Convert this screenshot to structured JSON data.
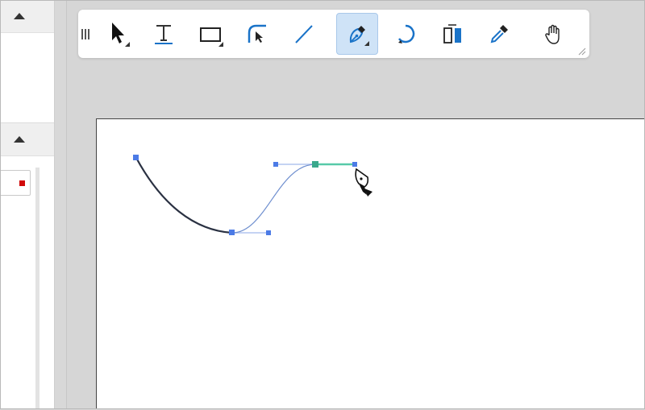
{
  "left_panel": {
    "sections": [
      {
        "name": "section-1",
        "collapse_icon": "triangle-up-icon"
      },
      {
        "name": "section-2",
        "collapse_icon": "triangle-up-icon"
      }
    ],
    "color_swatch": "#d10a0a"
  },
  "toolbar": {
    "active_tool": "pen",
    "accent_color": "#1a73c8",
    "tools": [
      {
        "id": "select",
        "icon": "pointer-arrow-icon",
        "has_submenu": true
      },
      {
        "id": "text",
        "icon": "text-t-icon",
        "has_submenu": false
      },
      {
        "id": "rectangle",
        "icon": "rectangle-icon",
        "has_submenu": true
      },
      {
        "id": "direct-select",
        "icon": "corner-select-icon",
        "has_submenu": false
      },
      {
        "id": "line",
        "icon": "line-icon",
        "has_submenu": false
      },
      {
        "id": "pen",
        "icon": "pen-nib-icon",
        "has_submenu": true
      },
      {
        "id": "lasso",
        "icon": "lasso-icon",
        "has_submenu": false
      },
      {
        "id": "fill",
        "icon": "fill-bucket-icon",
        "has_submenu": false
      },
      {
        "id": "eyedropper",
        "icon": "eyedropper-icon",
        "has_submenu": false
      },
      {
        "id": "pan",
        "icon": "hand-icon",
        "has_submenu": false
      }
    ]
  },
  "canvas": {
    "background": "#ffffff",
    "path_color": "#2a3142",
    "preview_color": "#6f8fcf",
    "anchor_color": "#4c7be6",
    "active_handle_color": "#57c9a8",
    "cursor": "pen-cursor-icon"
  }
}
